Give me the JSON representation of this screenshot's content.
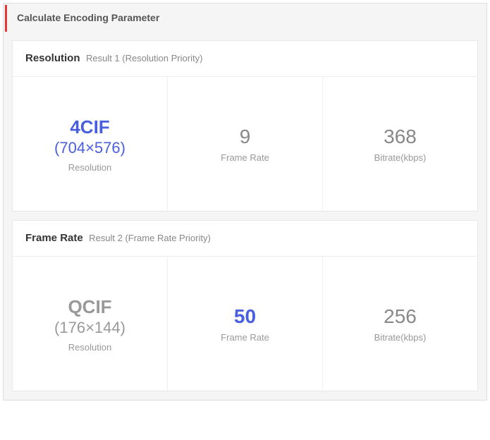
{
  "panel_title": "Calculate Encoding Parameter",
  "result1": {
    "header_primary": "Resolution",
    "header_secondary": "Result 1 (Resolution Priority)",
    "resolution_name": "4CIF",
    "resolution_dims": "(704×576)",
    "resolution_label": "Resolution",
    "frame_rate_value": "9",
    "frame_rate_label": "Frame Rate",
    "bitrate_value": "368",
    "bitrate_label": "Bitrate(kbps)"
  },
  "result2": {
    "header_primary": "Frame Rate",
    "header_secondary": "Result 2 (Frame Rate Priority)",
    "resolution_name": "QCIF",
    "resolution_dims": "(176×144)",
    "resolution_label": "Resolution",
    "frame_rate_value": "50",
    "frame_rate_label": "Frame Rate",
    "bitrate_value": "256",
    "bitrate_label": "Bitrate(kbps)"
  }
}
